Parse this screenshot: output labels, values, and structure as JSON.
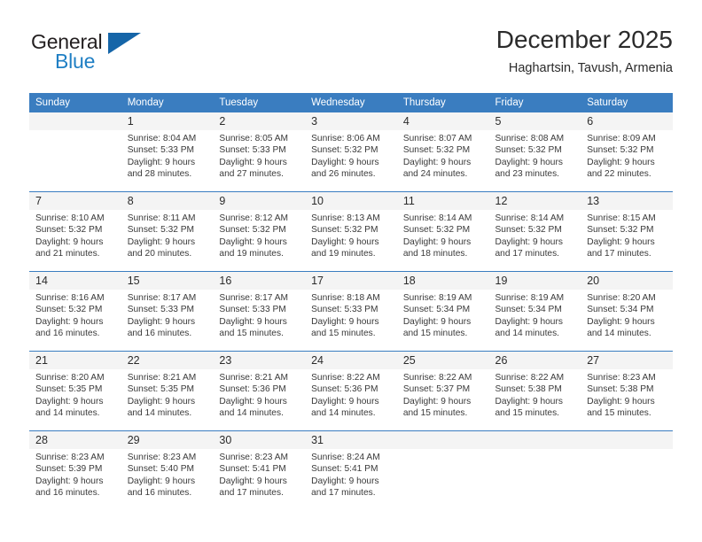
{
  "logo": {
    "primary_text": "General",
    "secondary_text": "Blue",
    "primary_color": "#231f20",
    "secondary_color": "#1f7fc4",
    "triangle_color": "#1565a8"
  },
  "header": {
    "title": "December 2025",
    "subtitle": "Haghartsin, Tavush, Armenia"
  },
  "theme": {
    "header_bg": "#3a7dc0",
    "header_text": "#ffffff",
    "daynum_bg": "#f4f4f4",
    "border": "#3a7dc0",
    "body_text": "#3a3a3a"
  },
  "weekdays": [
    "Sunday",
    "Monday",
    "Tuesday",
    "Wednesday",
    "Thursday",
    "Friday",
    "Saturday"
  ],
  "weeks": [
    [
      {
        "day": "",
        "sunrise": "",
        "sunset": "",
        "daylight1": "",
        "daylight2": ""
      },
      {
        "day": "1",
        "sunrise": "Sunrise: 8:04 AM",
        "sunset": "Sunset: 5:33 PM",
        "daylight1": "Daylight: 9 hours",
        "daylight2": "and 28 minutes."
      },
      {
        "day": "2",
        "sunrise": "Sunrise: 8:05 AM",
        "sunset": "Sunset: 5:33 PM",
        "daylight1": "Daylight: 9 hours",
        "daylight2": "and 27 minutes."
      },
      {
        "day": "3",
        "sunrise": "Sunrise: 8:06 AM",
        "sunset": "Sunset: 5:32 PM",
        "daylight1": "Daylight: 9 hours",
        "daylight2": "and 26 minutes."
      },
      {
        "day": "4",
        "sunrise": "Sunrise: 8:07 AM",
        "sunset": "Sunset: 5:32 PM",
        "daylight1": "Daylight: 9 hours",
        "daylight2": "and 24 minutes."
      },
      {
        "day": "5",
        "sunrise": "Sunrise: 8:08 AM",
        "sunset": "Sunset: 5:32 PM",
        "daylight1": "Daylight: 9 hours",
        "daylight2": "and 23 minutes."
      },
      {
        "day": "6",
        "sunrise": "Sunrise: 8:09 AM",
        "sunset": "Sunset: 5:32 PM",
        "daylight1": "Daylight: 9 hours",
        "daylight2": "and 22 minutes."
      }
    ],
    [
      {
        "day": "7",
        "sunrise": "Sunrise: 8:10 AM",
        "sunset": "Sunset: 5:32 PM",
        "daylight1": "Daylight: 9 hours",
        "daylight2": "and 21 minutes."
      },
      {
        "day": "8",
        "sunrise": "Sunrise: 8:11 AM",
        "sunset": "Sunset: 5:32 PM",
        "daylight1": "Daylight: 9 hours",
        "daylight2": "and 20 minutes."
      },
      {
        "day": "9",
        "sunrise": "Sunrise: 8:12 AM",
        "sunset": "Sunset: 5:32 PM",
        "daylight1": "Daylight: 9 hours",
        "daylight2": "and 19 minutes."
      },
      {
        "day": "10",
        "sunrise": "Sunrise: 8:13 AM",
        "sunset": "Sunset: 5:32 PM",
        "daylight1": "Daylight: 9 hours",
        "daylight2": "and 19 minutes."
      },
      {
        "day": "11",
        "sunrise": "Sunrise: 8:14 AM",
        "sunset": "Sunset: 5:32 PM",
        "daylight1": "Daylight: 9 hours",
        "daylight2": "and 18 minutes."
      },
      {
        "day": "12",
        "sunrise": "Sunrise: 8:14 AM",
        "sunset": "Sunset: 5:32 PM",
        "daylight1": "Daylight: 9 hours",
        "daylight2": "and 17 minutes."
      },
      {
        "day": "13",
        "sunrise": "Sunrise: 8:15 AM",
        "sunset": "Sunset: 5:32 PM",
        "daylight1": "Daylight: 9 hours",
        "daylight2": "and 17 minutes."
      }
    ],
    [
      {
        "day": "14",
        "sunrise": "Sunrise: 8:16 AM",
        "sunset": "Sunset: 5:32 PM",
        "daylight1": "Daylight: 9 hours",
        "daylight2": "and 16 minutes."
      },
      {
        "day": "15",
        "sunrise": "Sunrise: 8:17 AM",
        "sunset": "Sunset: 5:33 PM",
        "daylight1": "Daylight: 9 hours",
        "daylight2": "and 16 minutes."
      },
      {
        "day": "16",
        "sunrise": "Sunrise: 8:17 AM",
        "sunset": "Sunset: 5:33 PM",
        "daylight1": "Daylight: 9 hours",
        "daylight2": "and 15 minutes."
      },
      {
        "day": "17",
        "sunrise": "Sunrise: 8:18 AM",
        "sunset": "Sunset: 5:33 PM",
        "daylight1": "Daylight: 9 hours",
        "daylight2": "and 15 minutes."
      },
      {
        "day": "18",
        "sunrise": "Sunrise: 8:19 AM",
        "sunset": "Sunset: 5:34 PM",
        "daylight1": "Daylight: 9 hours",
        "daylight2": "and 15 minutes."
      },
      {
        "day": "19",
        "sunrise": "Sunrise: 8:19 AM",
        "sunset": "Sunset: 5:34 PM",
        "daylight1": "Daylight: 9 hours",
        "daylight2": "and 14 minutes."
      },
      {
        "day": "20",
        "sunrise": "Sunrise: 8:20 AM",
        "sunset": "Sunset: 5:34 PM",
        "daylight1": "Daylight: 9 hours",
        "daylight2": "and 14 minutes."
      }
    ],
    [
      {
        "day": "21",
        "sunrise": "Sunrise: 8:20 AM",
        "sunset": "Sunset: 5:35 PM",
        "daylight1": "Daylight: 9 hours",
        "daylight2": "and 14 minutes."
      },
      {
        "day": "22",
        "sunrise": "Sunrise: 8:21 AM",
        "sunset": "Sunset: 5:35 PM",
        "daylight1": "Daylight: 9 hours",
        "daylight2": "and 14 minutes."
      },
      {
        "day": "23",
        "sunrise": "Sunrise: 8:21 AM",
        "sunset": "Sunset: 5:36 PM",
        "daylight1": "Daylight: 9 hours",
        "daylight2": "and 14 minutes."
      },
      {
        "day": "24",
        "sunrise": "Sunrise: 8:22 AM",
        "sunset": "Sunset: 5:36 PM",
        "daylight1": "Daylight: 9 hours",
        "daylight2": "and 14 minutes."
      },
      {
        "day": "25",
        "sunrise": "Sunrise: 8:22 AM",
        "sunset": "Sunset: 5:37 PM",
        "daylight1": "Daylight: 9 hours",
        "daylight2": "and 15 minutes."
      },
      {
        "day": "26",
        "sunrise": "Sunrise: 8:22 AM",
        "sunset": "Sunset: 5:38 PM",
        "daylight1": "Daylight: 9 hours",
        "daylight2": "and 15 minutes."
      },
      {
        "day": "27",
        "sunrise": "Sunrise: 8:23 AM",
        "sunset": "Sunset: 5:38 PM",
        "daylight1": "Daylight: 9 hours",
        "daylight2": "and 15 minutes."
      }
    ],
    [
      {
        "day": "28",
        "sunrise": "Sunrise: 8:23 AM",
        "sunset": "Sunset: 5:39 PM",
        "daylight1": "Daylight: 9 hours",
        "daylight2": "and 16 minutes."
      },
      {
        "day": "29",
        "sunrise": "Sunrise: 8:23 AM",
        "sunset": "Sunset: 5:40 PM",
        "daylight1": "Daylight: 9 hours",
        "daylight2": "and 16 minutes."
      },
      {
        "day": "30",
        "sunrise": "Sunrise: 8:23 AM",
        "sunset": "Sunset: 5:41 PM",
        "daylight1": "Daylight: 9 hours",
        "daylight2": "and 17 minutes."
      },
      {
        "day": "31",
        "sunrise": "Sunrise: 8:24 AM",
        "sunset": "Sunset: 5:41 PM",
        "daylight1": "Daylight: 9 hours",
        "daylight2": "and 17 minutes."
      },
      {
        "day": "",
        "sunrise": "",
        "sunset": "",
        "daylight1": "",
        "daylight2": ""
      },
      {
        "day": "",
        "sunrise": "",
        "sunset": "",
        "daylight1": "",
        "daylight2": ""
      },
      {
        "day": "",
        "sunrise": "",
        "sunset": "",
        "daylight1": "",
        "daylight2": ""
      }
    ]
  ]
}
